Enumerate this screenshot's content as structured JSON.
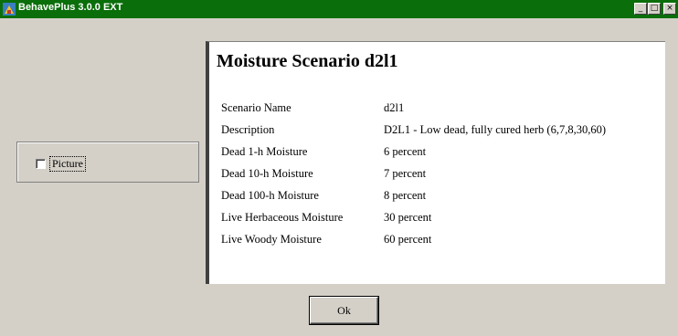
{
  "window": {
    "title": "BehavePlus 3.0.0 EXT",
    "minimize_glyph": "_",
    "maximize_glyph": "□",
    "close_glyph": "×"
  },
  "left_panel": {
    "checkbox_label": "Picture",
    "checked": false
  },
  "report": {
    "title": "Moisture Scenario d2l1",
    "rows": [
      {
        "label": "Scenario Name",
        "value": "d2l1"
      },
      {
        "label": "Description",
        "value": "D2L1 - Low dead, fully cured herb (6,7,8,30,60)"
      },
      {
        "label": "Dead 1-h Moisture",
        "value": "6 percent"
      },
      {
        "label": "Dead 10-h Moisture",
        "value": "7 percent"
      },
      {
        "label": "Dead 100-h Moisture",
        "value": "8 percent"
      },
      {
        "label": "Live Herbaceous Moisture",
        "value": "30 percent"
      },
      {
        "label": "Live Woody Moisture",
        "value": "60 percent"
      }
    ]
  },
  "buttons": {
    "ok_label": "Ok"
  },
  "colors": {
    "titlebar": "#0a6e0a",
    "dialog_bg": "#d4d0c8"
  },
  "icons": {
    "app": "behaveplus-icon"
  }
}
